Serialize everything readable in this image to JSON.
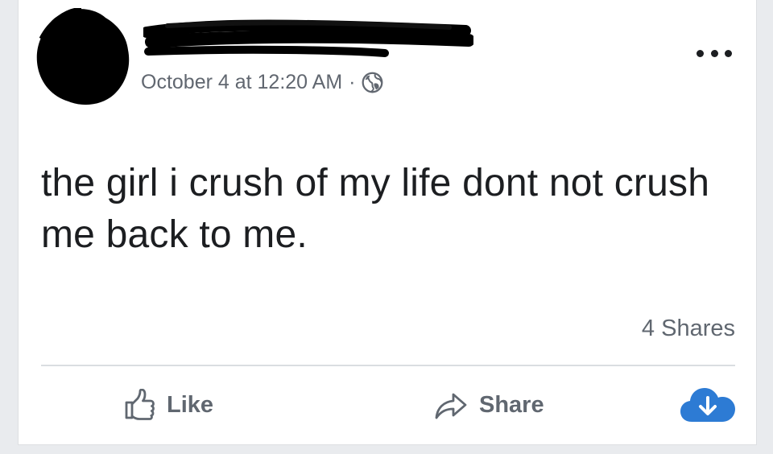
{
  "post": {
    "timestamp": "October 4 at 12:20 AM",
    "separator": "·",
    "privacy_icon": "globe-icon",
    "more_icon": "more-options-icon",
    "text": "the girl i crush of my life dont not crush me back to me.",
    "shares_label": "4 Shares"
  },
  "actions": {
    "like_label": "Like",
    "like_icon": "thumbs-up-icon",
    "share_label": "Share",
    "share_icon": "share-arrow-icon",
    "download_icon": "cloud-download-icon"
  },
  "colors": {
    "text": "#1c1e21",
    "secondary_text": "#606770",
    "divider": "#dadde1",
    "cloud_blue": "#2d7bd4",
    "redaction": "#000000"
  }
}
